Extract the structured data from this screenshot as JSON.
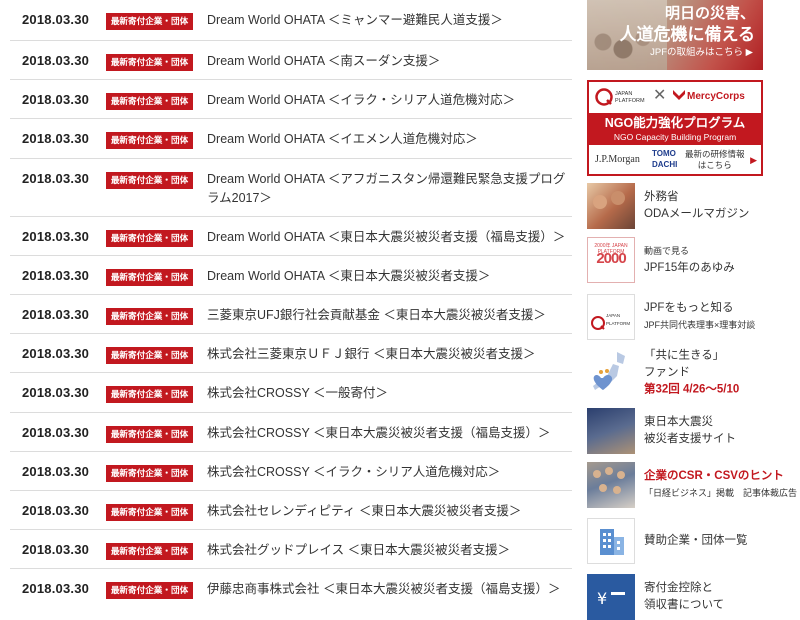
{
  "news": {
    "items": [
      {
        "date": "2018.03.30",
        "badge": "最新寄付企業・団体",
        "title": "Dream World OHATA ＜ミャンマー避難民人道支援＞"
      },
      {
        "date": "2018.03.30",
        "badge": "最新寄付企業・団体",
        "title": "Dream World OHATA ＜南スーダン支援＞"
      },
      {
        "date": "2018.03.30",
        "badge": "最新寄付企業・団体",
        "title": "Dream World OHATA ＜イラク・シリア人道危機対応＞"
      },
      {
        "date": "2018.03.30",
        "badge": "最新寄付企業・団体",
        "title": "Dream World OHATA ＜イエメン人道危機対応＞"
      },
      {
        "date": "2018.03.30",
        "badge": "最新寄付企業・団体",
        "title": "Dream World OHATA ＜アフガニスタン帰還難民緊急支援プログラム2017＞"
      },
      {
        "date": "2018.03.30",
        "badge": "最新寄付企業・団体",
        "title": "Dream World OHATA ＜東日本大震災被災者支援（福島支援）＞"
      },
      {
        "date": "2018.03.30",
        "badge": "最新寄付企業・団体",
        "title": "Dream World OHATA ＜東日本大震災被災者支援＞"
      },
      {
        "date": "2018.03.30",
        "badge": "最新寄付企業・団体",
        "title": "三菱東京UFJ銀行社会貢献基金 ＜東日本大震災被災者支援＞"
      },
      {
        "date": "2018.03.30",
        "badge": "最新寄付企業・団体",
        "title": "株式会社三菱東京ＵＦＪ銀行 ＜東日本大震災被災者支援＞"
      },
      {
        "date": "2018.03.30",
        "badge": "最新寄付企業・団体",
        "title": "株式会社CROSSY ＜一般寄付＞"
      },
      {
        "date": "2018.03.30",
        "badge": "最新寄付企業・団体",
        "title": "株式会社CROSSY ＜東日本大震災被災者支援（福島支援）＞"
      },
      {
        "date": "2018.03.30",
        "badge": "最新寄付企業・団体",
        "title": "株式会社CROSSY ＜イラク・シリア人道危機対応＞"
      },
      {
        "date": "2018.03.30",
        "badge": "最新寄付企業・団体",
        "title": "株式会社セレンディピティ ＜東日本大震災被災者支援＞"
      },
      {
        "date": "2018.03.30",
        "badge": "最新寄付企業・団体",
        "title": "株式会社グッドプレイス ＜東日本大震災被災者支援＞"
      },
      {
        "date": "2018.03.30",
        "badge": "最新寄付企業・団体",
        "title": "伊藤忠商事株式会社 ＜東日本大震災被災者支援（福島支援）＞"
      }
    ]
  },
  "sidebar": {
    "disaster_banner": {
      "line1": "明日の災害、",
      "line2": "人道危機に備える",
      "line3": "JPFの取組みはこちら ▶"
    },
    "ngo_banner": {
      "jpf_logo_text": "JAPAN PLATFORM",
      "cross": "✕",
      "mercy": "MercyCorps",
      "title": "NGO能力強化プログラム",
      "subtitle": "NGO Capacity Building Program",
      "jpmorgan": "J.P.Morgan",
      "tomodachi": "TOMO DACHI",
      "info_line1": "最新の研修情報",
      "info_line2": "はこちら",
      "arrow": "▶"
    },
    "links": [
      {
        "line1": "外務省",
        "line2": "ODAメールマガジン",
        "icon": "odamail-thumb"
      },
      {
        "line1": "動画で見る",
        "line2": "JPF15年のあゆみ",
        "thumb_big": "2000",
        "thumb_tiny": "2000年 JAPAN PLATFORM",
        "icon": "jpf15-thumb"
      },
      {
        "line1": "JPFをもっと知る",
        "line2": "JPF共同代表理事×理事対談",
        "icon": "jpf-logo-thumb"
      },
      {
        "line1": "「共に生きる」",
        "line2": "ファンド",
        "line3": "第32回 4/26〜5/10",
        "icon": "map-thumb"
      },
      {
        "line1": "東日本大震災",
        "line2": "被災者支援サイト",
        "icon": "tohoku-thumb"
      },
      {
        "line1": "企業のCSR・CSVのヒント",
        "line2": "「日経ビジネス」掲載　記事体裁広告",
        "icon": "csr-thumb"
      },
      {
        "line1": "賛助企業・団体一覧",
        "icon": "building-icon"
      },
      {
        "line1": "寄付金控除と",
        "line2": "領収書について",
        "icon": "tax-icon"
      }
    ]
  },
  "colors": {
    "badge_red": "#c2181f",
    "text": "#333333",
    "divider": "#dcdcdc"
  }
}
